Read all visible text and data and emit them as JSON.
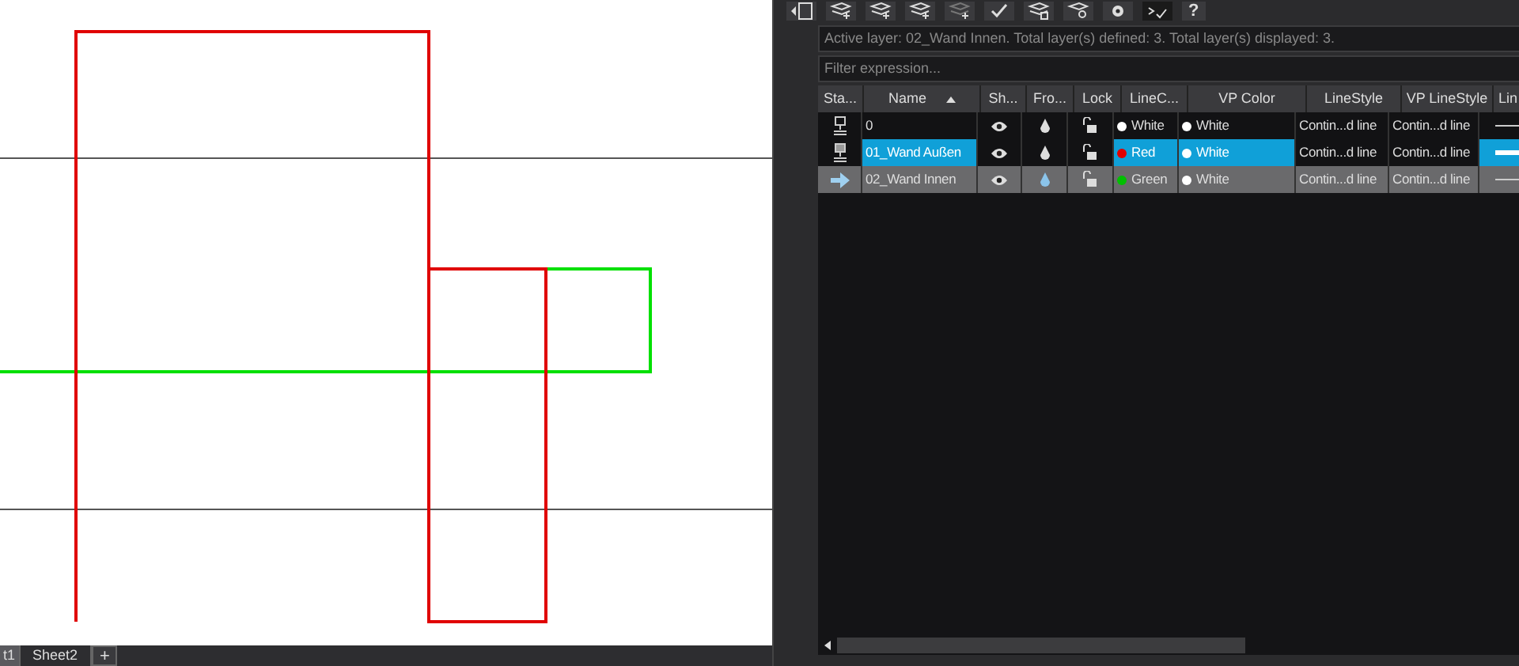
{
  "toolbar": {
    "help_label": "?"
  },
  "status_text": "Active layer: 02_Wand Innen. Total layer(s) defined: 3. Total layer(s) displayed: 3.",
  "filter": {
    "placeholder": "Filter expression..."
  },
  "table": {
    "columns": [
      "Sta...",
      "Name",
      "Sh...",
      "Fro...",
      "Lock",
      "LineC...",
      "VP Color",
      "LineStyle",
      "VP LineStyle",
      "Lin"
    ],
    "rows": [
      {
        "name": "0",
        "current": false,
        "selected": false,
        "shown": true,
        "frozen": false,
        "locked": false,
        "line_color": {
          "label": "White",
          "color": "#ffffff"
        },
        "vp_color": {
          "label": "White",
          "color": "#ffffff"
        },
        "linestyle": "Contin...d line",
        "vp_linestyle": "Contin...d line"
      },
      {
        "name": "01_Wand Außen",
        "current": false,
        "selected": true,
        "shown": true,
        "frozen": false,
        "locked": false,
        "line_color": {
          "label": "Red",
          "color": "#e00000"
        },
        "vp_color": {
          "label": "White",
          "color": "#ffffff"
        },
        "linestyle": "Contin...d line",
        "vp_linestyle": "Contin...d line"
      },
      {
        "name": "02_Wand Innen",
        "current": true,
        "selected": false,
        "shown": true,
        "frozen": false,
        "locked": false,
        "line_color": {
          "label": "Green",
          "color": "#00c000"
        },
        "vp_color": {
          "label": "White",
          "color": "#ffffff"
        },
        "linestyle": "Contin...d line",
        "vp_linestyle": "Contin...d line"
      }
    ]
  },
  "sheet_tabs": [
    {
      "label": "t1",
      "selected": true
    },
    {
      "label": "Sheet2",
      "selected": false
    }
  ],
  "add_sheet_label": "+"
}
